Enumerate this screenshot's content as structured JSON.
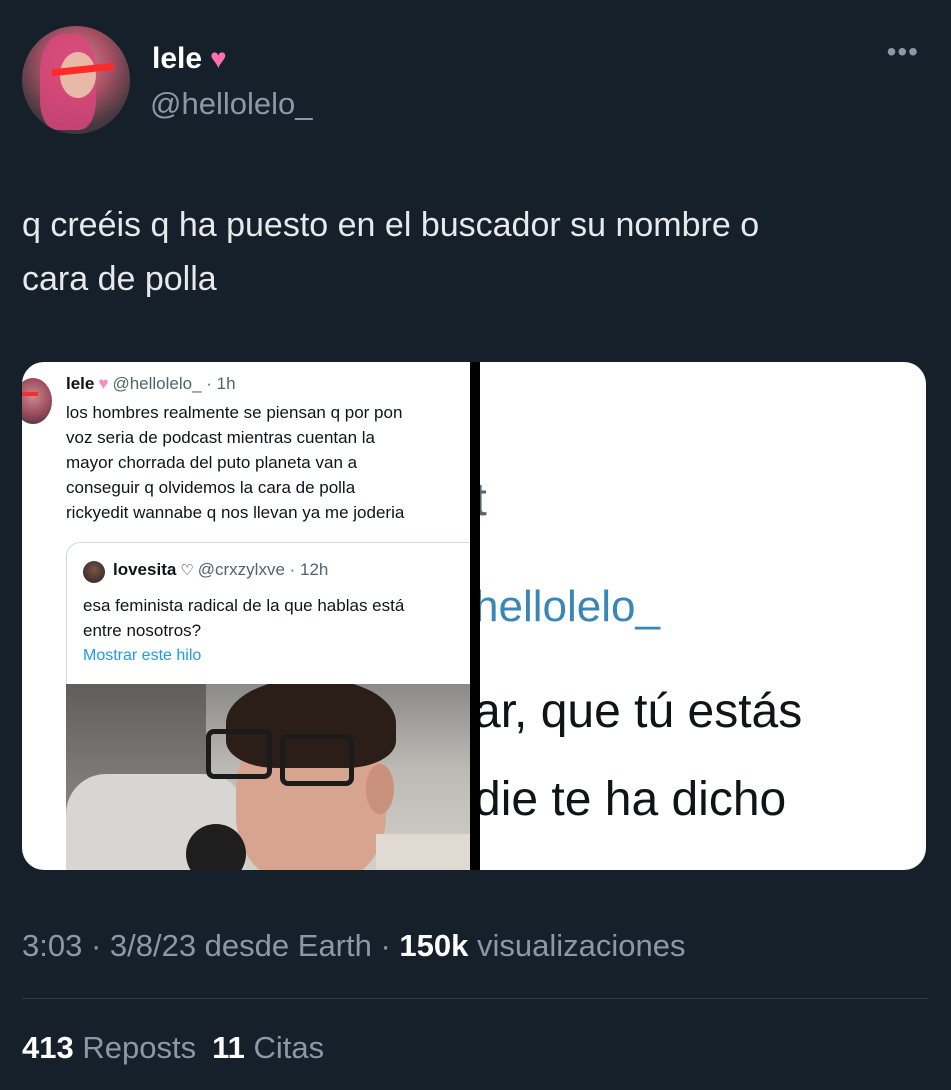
{
  "author": {
    "name": "lele",
    "handle": "@hellolelo_",
    "badge_icon": "pink-heart-icon"
  },
  "more_icon": "more-options-icon",
  "tweet": {
    "text_line1": "q creéis q ha puesto en el buscador su nombre o",
    "text_line2": "cara de polla"
  },
  "media": {
    "left_screenshot": {
      "name": "lele",
      "handle_time": "@hellolelo_ · 1h",
      "lines": [
        "los hombres realmente se piensan q por pon",
        "voz seria de podcast mientras cuentan la",
        "mayor chorrada del puto planeta van a",
        "conseguir q olvidemos la cara de polla",
        "rickyedit wannabe q nos llevan ya me joderia"
      ],
      "quote": {
        "name": "lovesita",
        "heart": "♡",
        "handle_time": "@crxzylxve · 12h",
        "lines": [
          "esa feminista radical de la que hablas está",
          "entre nosotros?"
        ],
        "link": "Mostrar este hilo"
      }
    },
    "right_screenshot": {
      "lines": [
        "t",
        "hellolelo_",
        "ar, que tú estás",
        "die te ha dicho"
      ]
    }
  },
  "meta": {
    "time_date_source": "3:03 · 3/8/23 desde Earth · ",
    "views_count": "150k",
    "views_label": " visualizaciones"
  },
  "stats": {
    "reposts_count": "413",
    "reposts_label": " Reposts",
    "quotes_count": "11",
    "quotes_label": " Citas"
  },
  "colors": {
    "background": "#15202b",
    "text": "#e7e9ea",
    "secondary": "#8b98a5",
    "heart": "#ff6fb4",
    "link": "#1d9bf0"
  }
}
